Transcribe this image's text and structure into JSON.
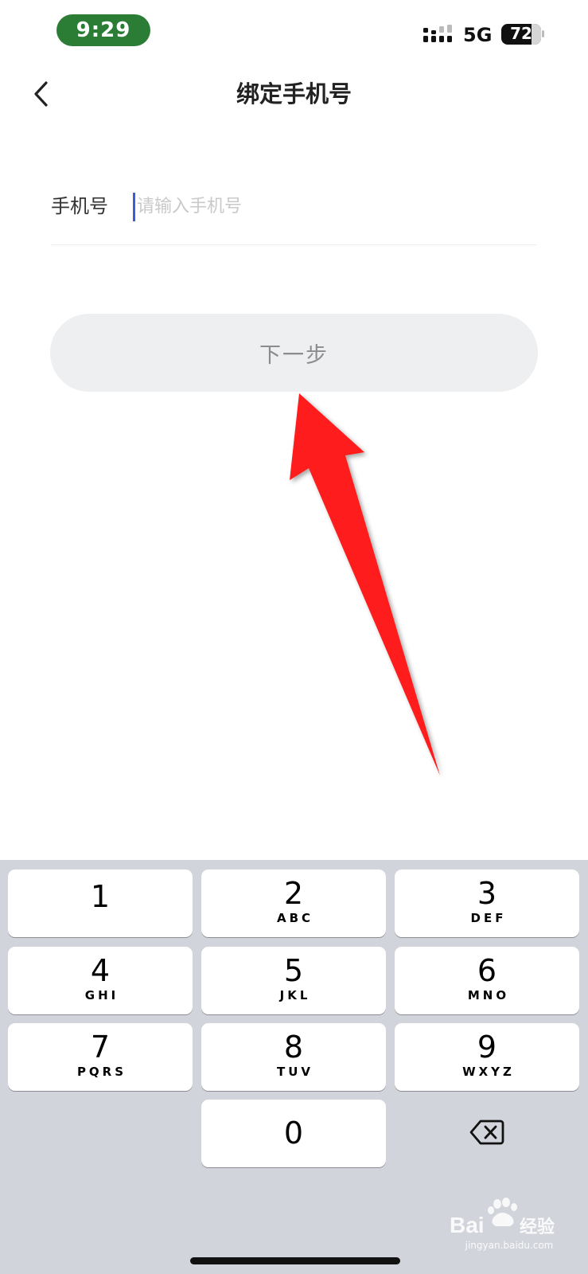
{
  "status_bar": {
    "time": "9:29",
    "network": "5G",
    "battery": "72",
    "time_pill_color": "#2b7d36"
  },
  "nav": {
    "back_icon": "chevron-left-icon",
    "title": "绑定手机号"
  },
  "form": {
    "phone_label": "手机号",
    "phone_placeholder": "请输入手机号",
    "phone_value": ""
  },
  "actions": {
    "next_label": "下一步",
    "next_enabled": false
  },
  "annotation": {
    "arrow_color": "#ff1a1a"
  },
  "keypad": {
    "keys": [
      {
        "digit": "1",
        "letters": ""
      },
      {
        "digit": "2",
        "letters": "ABC"
      },
      {
        "digit": "3",
        "letters": "DEF"
      },
      {
        "digit": "4",
        "letters": "GHI"
      },
      {
        "digit": "5",
        "letters": "JKL"
      },
      {
        "digit": "6",
        "letters": "MNO"
      },
      {
        "digit": "7",
        "letters": "PQRS"
      },
      {
        "digit": "8",
        "letters": "TUV"
      },
      {
        "digit": "9",
        "letters": "WXYZ"
      },
      {
        "digit": "0",
        "letters": ""
      }
    ],
    "delete_icon": "backspace-icon"
  },
  "watermark": {
    "text": "jingyan.baidu.com"
  }
}
